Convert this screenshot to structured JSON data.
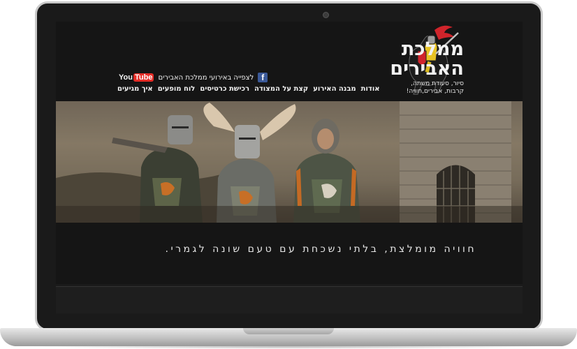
{
  "site": {
    "logo_title_line1": "ממלכת",
    "logo_title_line2": "האבירים",
    "logo_tagline_line1": "סיור, סעודת משתה,",
    "logo_tagline_line2": "קרבות, אבירים,חוויה!"
  },
  "social": {
    "facebook_icon": "f",
    "watch_videos_label": "לצפייה באירועי ממלכת האבירים",
    "youtube_you": "You",
    "youtube_tube": "Tube"
  },
  "nav": {
    "items": [
      {
        "label": "אודות"
      },
      {
        "label": "מבנה האירוע"
      },
      {
        "label": "קצת על המצודה"
      },
      {
        "label": "רכישת כרטיסים"
      },
      {
        "label": "לוח מופעים"
      },
      {
        "label": "איך מגיעים"
      }
    ]
  },
  "hero": {
    "slogan": "חוויה מומלצת, בלתי נשכחת עם טעם שונה לגמרי."
  },
  "colors": {
    "background": "#151515",
    "text": "#f2f2f2",
    "facebook": "#3b5998",
    "youtube": "#e52d27"
  },
  "icons": [
    "facebook-icon",
    "youtube-icon",
    "knight-logo-icon",
    "webcam-icon"
  ]
}
